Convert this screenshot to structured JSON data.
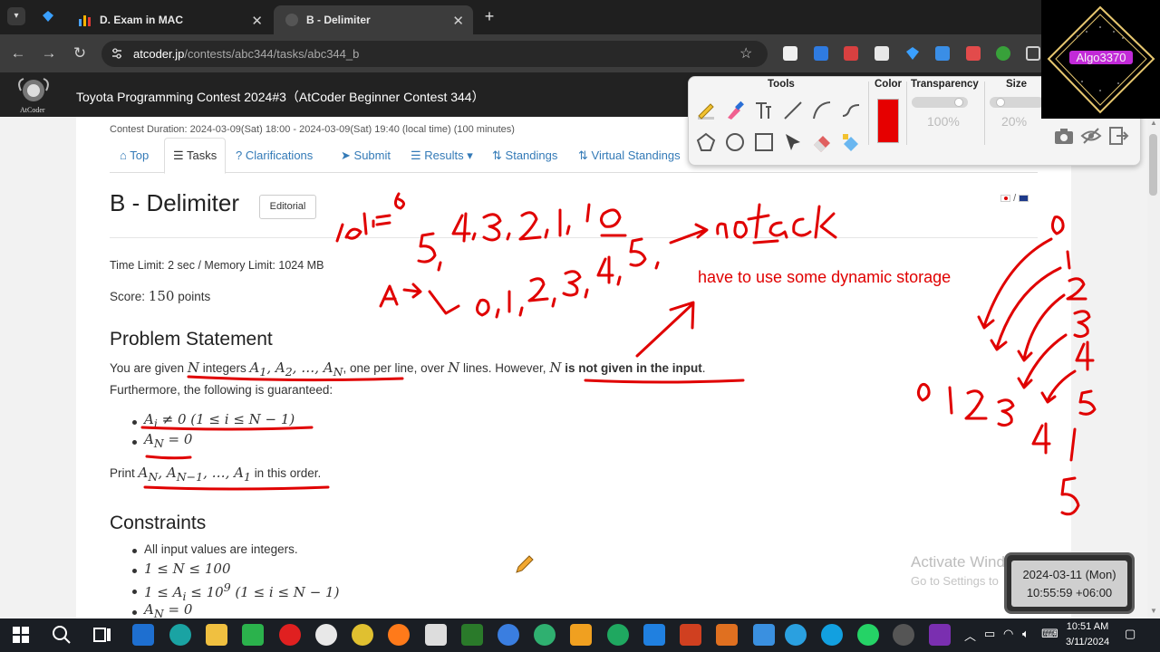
{
  "browser": {
    "tabs": [
      {
        "label": "D. Exam in MAC",
        "close": "✕"
      },
      {
        "label": "B - Delimiter",
        "close": "✕"
      }
    ],
    "new_tab": "+",
    "url_host": "atcoder.jp",
    "url_path": "/contests/abc344/tasks/abc344_b"
  },
  "site": {
    "logo_text": "AtCoder",
    "contest_title": "Toyota Programming Contest 2024#3（AtCoder Beginner Contest 344）",
    "duration": "Contest Duration: 2024-03-09(Sat) 18:00 - 2024-03-09(Sat) 19:40 (local time) (100 minutes)",
    "nav_tabs": [
      "Top",
      "Tasks",
      "Clarifications",
      "Submit",
      "Results",
      "Standings",
      "Virtual Standings"
    ],
    "lang_sep": "/"
  },
  "task": {
    "title": "B - Delimiter",
    "editorial": "Editorial",
    "limits": "Time Limit: 2 sec / Memory Limit: 1024 MB",
    "score_label": "Score:",
    "score_value": "150",
    "score_unit": "points",
    "problem_heading": "Problem Statement",
    "stmt_1": "You are given",
    "stmt_2": "integers",
    "stmt_3": "one per line, over",
    "stmt_4": "lines. However,",
    "stmt_5": "is not given in the input",
    "guaranteed": "Furthermore, the following is guaranteed:",
    "print_1": "Print",
    "print_2": "in this order.",
    "constraints_heading": "Constraints",
    "constraint_1": "All input values are integers."
  },
  "toolbox": {
    "tools_label": "Tools",
    "color_label": "Color",
    "transparency_label": "Transparency",
    "transparency_value": "100%",
    "size_label": "Size",
    "size_value": "20%",
    "color": "#e60000"
  },
  "watermark": {
    "text": "Algo3370"
  },
  "annotations": {
    "note": "have to use some dynamic storage",
    "ink_color": "#e00000"
  },
  "overlay": {
    "activate_title": "Activate Windows",
    "activate_sub": "Go to Settings to",
    "date": "2024-03-11 (Mon)",
    "time": "10:55:59 +06:00"
  },
  "taskbar": {
    "time": "10:51 AM",
    "date": "3/11/2024"
  }
}
